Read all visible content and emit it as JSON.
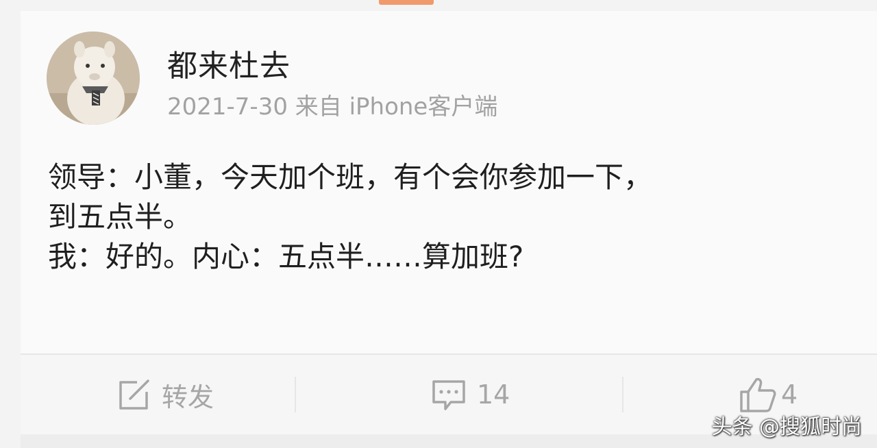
{
  "post": {
    "username": "都来杜去",
    "meta": "2021-7-30 来自 iPhone客户端",
    "lines": [
      "领导：小董，今天加个班，有个会你参加一下，",
      "到五点半。",
      "我：好的。内心：五点半……算加班?"
    ]
  },
  "actions": {
    "repost_label": "转发",
    "comment_count": "14",
    "like_count": "4"
  },
  "watermark": "头条 @搜狐时尚",
  "colors": {
    "accent_tab": "#f09a6b",
    "muted_text": "#a2a2a2",
    "icon_gray": "#a6a6a6"
  }
}
